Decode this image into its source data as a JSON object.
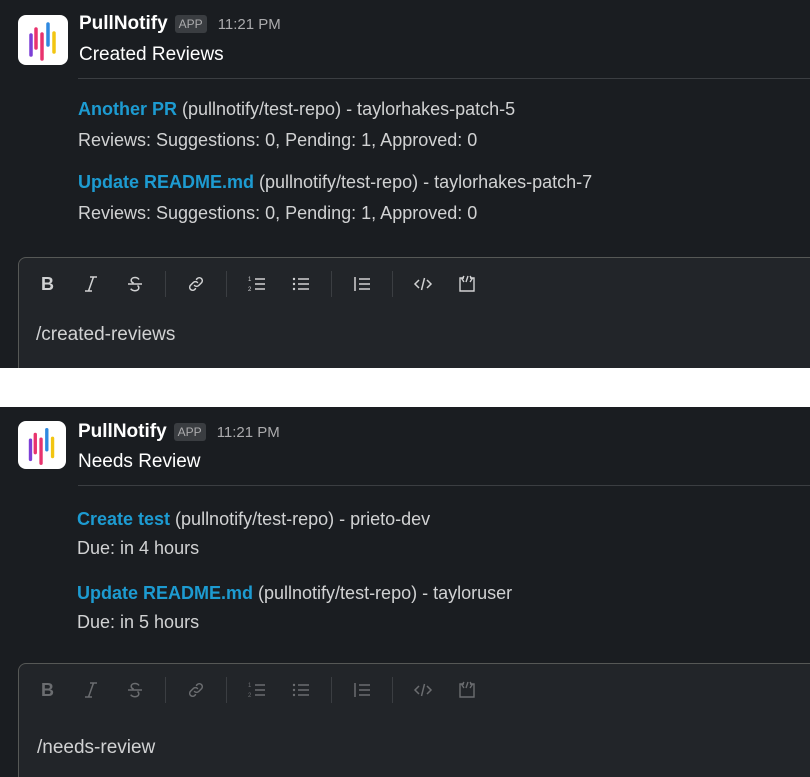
{
  "messages": [
    {
      "sender": "PullNotify",
      "badge": "APP",
      "time": "11:21 PM",
      "title": "Created Reviews",
      "items": [
        {
          "link": "Another PR",
          "detail": " (pullnotify/test-repo) -  taylorhakes-patch-5",
          "sub": "Reviews: Suggestions: 0, Pending: 1, Approved: 0"
        },
        {
          "link": "Update README.md",
          "detail": " (pullnotify/test-repo) -  taylorhakes-patch-7",
          "sub": "Reviews: Suggestions: 0, Pending: 1, Approved: 0"
        }
      ],
      "composer_text": "/created-reviews"
    },
    {
      "sender": "PullNotify",
      "badge": "APP",
      "time": "11:21 PM",
      "title": "Needs Review",
      "items": [
        {
          "link": "Create test",
          "detail": " (pullnotify/test-repo) - prieto-dev",
          "sub": "Due: in 4 hours"
        },
        {
          "link": "Update README.md",
          "detail": " (pullnotify/test-repo) - tayloruser",
          "sub": "Due: in 5 hours"
        }
      ],
      "composer_text": "/needs-review"
    }
  ],
  "icons": {
    "bold": "bold-icon",
    "italic": "italic-icon",
    "strike": "strikethrough-icon",
    "link": "link-icon",
    "ordered_list": "ordered-list-icon",
    "bullet_list": "bullet-list-icon",
    "blockquote": "blockquote-icon",
    "code": "code-icon",
    "code_block": "code-block-icon"
  },
  "colors": {
    "background": "#1a1d21",
    "link": "#1d9bd1",
    "text": "#d1d2d3",
    "logo_bars": [
      "#e8336e",
      "#7c3fd6",
      "#2f89e0",
      "#f2c511"
    ]
  }
}
